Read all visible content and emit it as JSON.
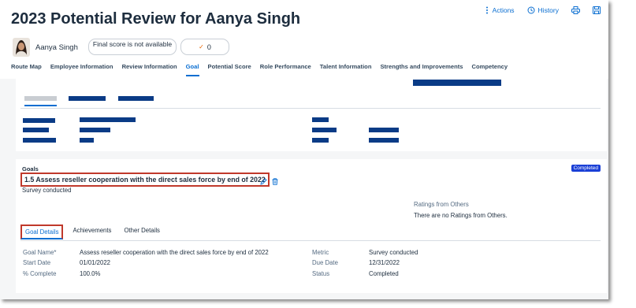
{
  "header": {
    "title": "2023 Potential Review for Aanya Singh",
    "actions_label": "Actions",
    "history_label": "History",
    "employee_name": "Aanya Singh",
    "score_text": "Final score is not available",
    "check_count": "0"
  },
  "tabs": [
    {
      "label": "Route Map"
    },
    {
      "label": "Employee Information"
    },
    {
      "label": "Review Information"
    },
    {
      "label": "Goal",
      "active": true
    },
    {
      "label": "Potential Score"
    },
    {
      "label": "Role Performance"
    },
    {
      "label": "Talent Information"
    },
    {
      "label": "Strengths and Improvements"
    },
    {
      "label": "Competency"
    }
  ],
  "goal": {
    "section_label": "Goals",
    "title": "1.5 Assess reseller cooperation with the direct sales force by end of 2022",
    "subtitle": "Survey conducted",
    "status_badge": "Completed",
    "ratings_label": "Ratings from Others",
    "ratings_text": "There are no Ratings from Others.",
    "detail_tabs": [
      {
        "label": "Goal Details",
        "active": true
      },
      {
        "label": "Achievements"
      },
      {
        "label": "Other Details"
      }
    ],
    "fields": {
      "goal_name_label": "Goal Name*",
      "goal_name_value": "Assess reseller cooperation with the direct sales force by end of 2022",
      "start_date_label": "Start Date",
      "start_date_value": "01/01/2022",
      "percent_label": "% Complete",
      "percent_value": "100.0%",
      "metric_label": "Metric",
      "metric_value": "Survey conducted",
      "due_date_label": "Due Date",
      "due_date_value": "12/31/2022",
      "status_label": "Status",
      "status_value": "Completed"
    }
  },
  "colors": {
    "accent": "#0a6ed1",
    "redacted_bar": "#0a3b86",
    "highlight_border": "#c0392b",
    "badge_bg": "#1a3fd6"
  },
  "icons": [
    "actions-icon",
    "history-icon",
    "print-icon",
    "save-icon",
    "edit-icon",
    "delete-icon",
    "check-icon"
  ]
}
